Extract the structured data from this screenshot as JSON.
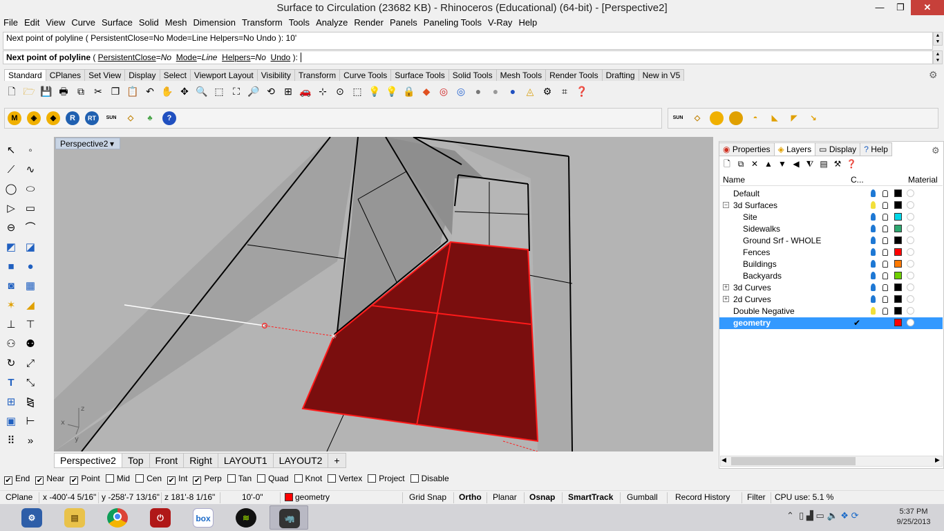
{
  "window": {
    "title": "Surface to Circulation (23682 KB) - Rhinoceros (Educational) (64-bit) - [Perspective2]",
    "minimize_glyph": "—",
    "restore_glyph": "❐",
    "close_glyph": "✕"
  },
  "menu": [
    "File",
    "Edit",
    "View",
    "Curve",
    "Surface",
    "Solid",
    "Mesh",
    "Dimension",
    "Transform",
    "Tools",
    "Analyze",
    "Render",
    "Panels",
    "Paneling Tools",
    "V-Ray",
    "Help"
  ],
  "command": {
    "history": "Next point of polyline ( PersistentClose=No  Mode=Line  Helpers=No  Undo ): 10'",
    "prompt_bold": "Next point of polyline",
    "prompt_open": " ( ",
    "opt1_key": "PersistentClose",
    "opt1_eq": "=",
    "opt1_val": "No",
    "opt2_key": "Mode",
    "opt2_eq": "=",
    "opt2_val": "Line",
    "opt3_key": "Helpers",
    "opt3_eq": "=",
    "opt3_val": "No",
    "opt4": "Undo",
    "prompt_close": " ): "
  },
  "toolbar_tabs": [
    "Standard",
    "CPlanes",
    "Set View",
    "Display",
    "Select",
    "Viewport Layout",
    "Visibility",
    "Transform",
    "Curve Tools",
    "Surface Tools",
    "Solid Tools",
    "Mesh Tools",
    "Render Tools",
    "Drafting",
    "New in V5"
  ],
  "toolbar2_labels": {
    "m": "M",
    "r": "R",
    "rt": "RT",
    "sun": "SUN",
    "help": "?"
  },
  "toolbar3_labels": {
    "sun": "SUN"
  },
  "viewport": {
    "label": "Perspective2",
    "axis_z": "z",
    "axis_x": "x",
    "axis_y": "y",
    "accent": "#7a0e0e"
  },
  "viewport_tabs": [
    "Perspective2",
    "Top",
    "Front",
    "Right",
    "LAYOUT1",
    "LAYOUT2"
  ],
  "viewport_tab_add": "+",
  "panel": {
    "tabs": [
      "Properties",
      "Layers",
      "Display",
      "Help"
    ],
    "columns": {
      "name": "Name",
      "color": "C...",
      "material": "Material"
    },
    "layers": [
      {
        "name": "Default",
        "indent": 0,
        "toggle": "",
        "light": "on",
        "color": "#000000",
        "selected": false,
        "current": ""
      },
      {
        "name": "3d Surfaces",
        "indent": 0,
        "toggle": "−",
        "light": "off",
        "color": "#000000",
        "selected": false,
        "current": ""
      },
      {
        "name": "Site",
        "indent": 1,
        "toggle": "",
        "light": "on",
        "color": "#00d8e8",
        "selected": false,
        "current": ""
      },
      {
        "name": "Sidewalks",
        "indent": 1,
        "toggle": "",
        "light": "on",
        "color": "#2ea870",
        "selected": false,
        "current": ""
      },
      {
        "name": "Ground Srf - WHOLE",
        "indent": 1,
        "toggle": "",
        "light": "on",
        "color": "#000000",
        "selected": false,
        "current": ""
      },
      {
        "name": "Fences",
        "indent": 1,
        "toggle": "",
        "light": "on",
        "color": "#ff0000",
        "selected": false,
        "current": ""
      },
      {
        "name": "Buildings",
        "indent": 1,
        "toggle": "",
        "light": "on",
        "color": "#ff7a00",
        "selected": false,
        "current": ""
      },
      {
        "name": "Backyards",
        "indent": 1,
        "toggle": "",
        "light": "on",
        "color": "#6ed000",
        "selected": false,
        "current": ""
      },
      {
        "name": "3d Curves",
        "indent": 0,
        "toggle": "+",
        "light": "on",
        "color": "#000000",
        "selected": false,
        "current": ""
      },
      {
        "name": "2d Curves",
        "indent": 0,
        "toggle": "+",
        "light": "on",
        "color": "#000000",
        "selected": false,
        "current": ""
      },
      {
        "name": "Double Negative",
        "indent": 0,
        "toggle": "",
        "light": "off",
        "color": "#000000",
        "selected": false,
        "current": ""
      },
      {
        "name": "geometry",
        "indent": 0,
        "toggle": "",
        "light": "none",
        "color": "#ff0000",
        "selected": true,
        "current": "✔"
      }
    ]
  },
  "osnap": [
    {
      "label": "End",
      "checked": true
    },
    {
      "label": "Near",
      "checked": true
    },
    {
      "label": "Point",
      "checked": true
    },
    {
      "label": "Mid",
      "checked": false
    },
    {
      "label": "Cen",
      "checked": false
    },
    {
      "label": "Int",
      "checked": true
    },
    {
      "label": "Perp",
      "checked": true
    },
    {
      "label": "Tan",
      "checked": false
    },
    {
      "label": "Quad",
      "checked": false
    },
    {
      "label": "Knot",
      "checked": false
    },
    {
      "label": "Vertex",
      "checked": false
    },
    {
      "label": "Project",
      "checked": false
    },
    {
      "label": "Disable",
      "checked": false
    }
  ],
  "status": {
    "cplane": "CPlane",
    "x": "x -400'-4 5/16\"",
    "y": "y -258'-7 13/16\"",
    "z": "z 181'-8 1/16\"",
    "distance": "10'-0\"",
    "layer": "geometry",
    "layer_color": "#ff0000",
    "grid_snap": "Grid Snap",
    "ortho": "Ortho",
    "planar": "Planar",
    "osnap": "Osnap",
    "smarttrack": "SmartTrack",
    "gumball": "Gumball",
    "record_history": "Record History",
    "filter": "Filter",
    "cpu": "CPU use: 5.1 %"
  },
  "taskbar": {
    "apps": [
      "control-panel",
      "file-explorer",
      "chrome",
      "power",
      "box",
      "spotify",
      "rhino"
    ],
    "box_label": "box",
    "clock_time": "5:37 PM",
    "clock_date": "9/25/2013"
  }
}
